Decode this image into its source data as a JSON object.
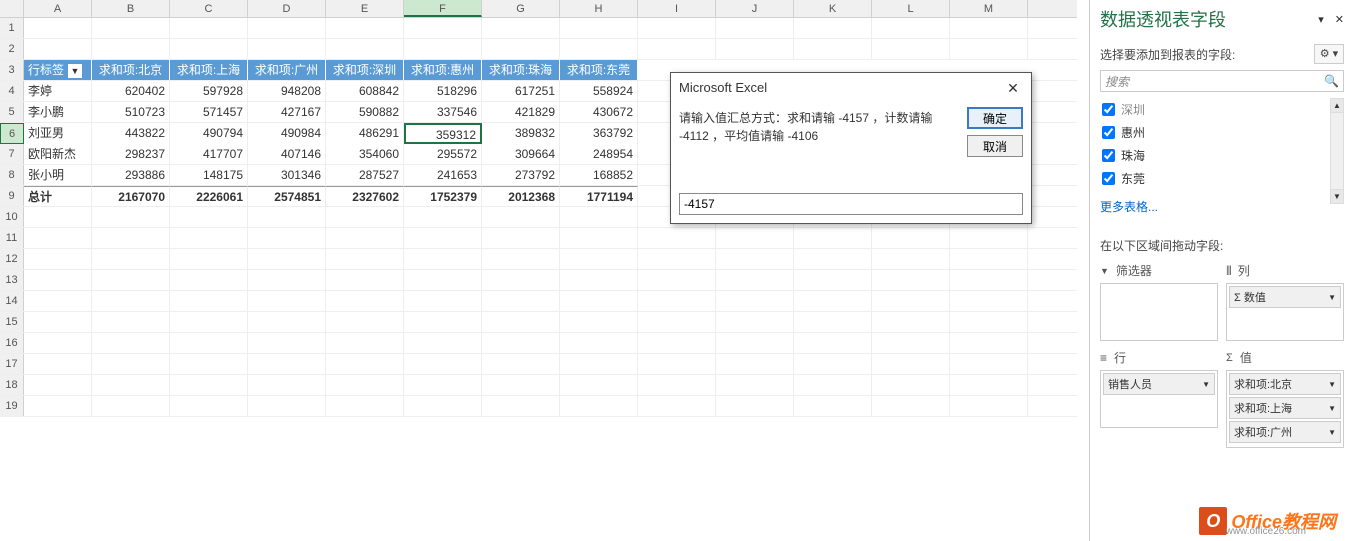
{
  "columns": [
    "A",
    "B",
    "C",
    "D",
    "E",
    "F",
    "G",
    "H",
    "I",
    "J",
    "K",
    "L",
    "M"
  ],
  "active_col_index": 5,
  "row_numbers": [
    1,
    2,
    3,
    4,
    5,
    6,
    7,
    8,
    9,
    10,
    11,
    12,
    13,
    14,
    15,
    16,
    17,
    18,
    19
  ],
  "active_row": 6,
  "pivot": {
    "headers": [
      "行标签",
      "求和项:北京",
      "求和项:上海",
      "求和项:广州",
      "求和项:深圳",
      "求和项:惠州",
      "求和项:珠海",
      "求和项:东莞"
    ],
    "rows": [
      {
        "label": "李婷",
        "vals": [
          620402,
          597928,
          948208,
          608842,
          518296,
          617251,
          558924
        ]
      },
      {
        "label": "李小鹏",
        "vals": [
          510723,
          571457,
          427167,
          590882,
          337546,
          421829,
          430672
        ]
      },
      {
        "label": "刘亚男",
        "vals": [
          443822,
          490794,
          490984,
          486291,
          359312,
          389832,
          363792
        ]
      },
      {
        "label": "欧阳新杰",
        "vals": [
          298237,
          417707,
          407146,
          354060,
          295572,
          309664,
          248954
        ]
      },
      {
        "label": "张小明",
        "vals": [
          293886,
          148175,
          301346,
          287527,
          241653,
          273792,
          168852
        ]
      }
    ],
    "total_label": "总计",
    "totals": [
      2167070,
      2226061,
      2574851,
      2327602,
      1752379,
      2012368,
      1771194
    ]
  },
  "dialog": {
    "title": "Microsoft Excel",
    "message": "请输入值汇总方式：求和请输 -4157 ，计数请输 -4112 ，平均值请输 -4106",
    "ok": "确定",
    "cancel": "取消",
    "input_value": "-4157"
  },
  "panel": {
    "title": "数据透视表字段",
    "close_glyph": "✕",
    "subtitle": "选择要添加到报表的字段:",
    "gear_glyph": "⚙ ▾",
    "search_placeholder": "搜索",
    "search_icon": "🔍",
    "fields": [
      {
        "label": "深圳",
        "checked": true,
        "dim": true
      },
      {
        "label": "惠州",
        "checked": true
      },
      {
        "label": "珠海",
        "checked": true
      },
      {
        "label": "东莞",
        "checked": true
      }
    ],
    "more_tables": "更多表格...",
    "drag_label": "在以下区域间拖动字段:",
    "area_filter": "筛选器",
    "area_columns": "列",
    "area_rows": "行",
    "area_values": "值",
    "col_items": [
      "Σ 数值"
    ],
    "row_items": [
      "销售人员"
    ],
    "val_items": [
      "求和项:北京",
      "求和项:上海",
      "求和项:广州"
    ]
  },
  "watermark": {
    "brand": "Office教程网",
    "url": "www.office26.com",
    "logo": "O"
  }
}
